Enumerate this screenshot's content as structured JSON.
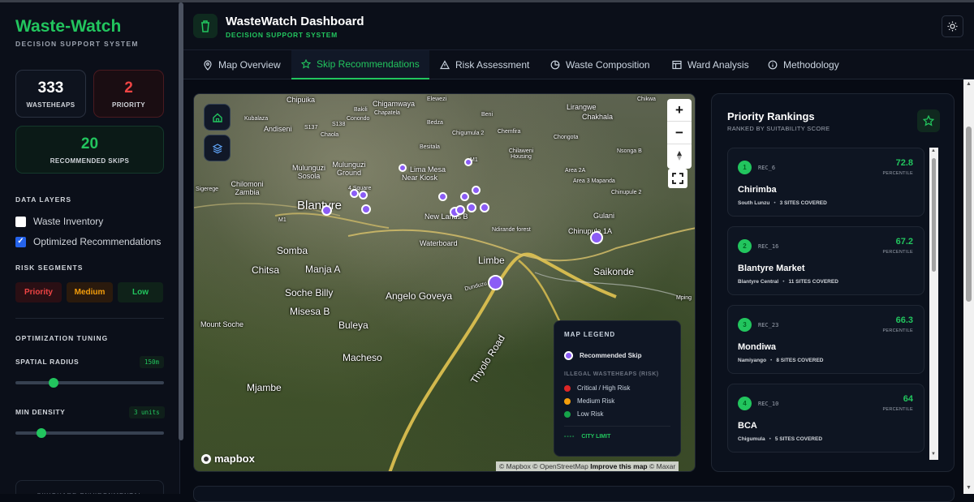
{
  "sidebar": {
    "brand": "Waste-Watch",
    "brand_sub": "DECISION SUPPORT SYSTEM",
    "stats": {
      "wasteheaps": {
        "value": "333",
        "label": "WASTEHEAPS"
      },
      "priority": {
        "value": "2",
        "label": "PRIORITY"
      },
      "recommended": {
        "value": "20",
        "label": "RECOMMENDED SKIPS"
      }
    },
    "data_layers_title": "DATA LAYERS",
    "layers": [
      {
        "label": "Waste Inventory",
        "checked": false
      },
      {
        "label": "Optimized Recommendations",
        "checked": true
      }
    ],
    "risk_title": "RISK SEGMENTS",
    "risk": [
      "Priority",
      "Medium",
      "Low"
    ],
    "tuning_title": "OPTIMIZATION TUNING",
    "spatial_radius": {
      "label": "SPATIAL RADIUS",
      "value": "150m",
      "level": 0.24
    },
    "min_density": {
      "label": "MIN DENSITY",
      "value": "3 units",
      "level": 0.15
    },
    "footer_card": "SKYGUARD ENVIRONMENTAL"
  },
  "header": {
    "title": "WasteWatch Dashboard",
    "subtitle": "DECISION SUPPORT SYSTEM"
  },
  "tabs": [
    {
      "label": "Map Overview",
      "icon": "map-pin-icon"
    },
    {
      "label": "Skip Recommendations",
      "icon": "star-icon",
      "active": true
    },
    {
      "label": "Risk Assessment",
      "icon": "warning-icon"
    },
    {
      "label": "Waste Composition",
      "icon": "pie-chart-icon"
    },
    {
      "label": "Ward Analysis",
      "icon": "table-icon"
    },
    {
      "label": "Methodology",
      "icon": "info-icon"
    }
  ],
  "map": {
    "labels": {
      "chipuika": "Chipuika",
      "bakili": "Bakili",
      "chigamwaya": "Chigamwaya",
      "chapatela": "Chapatela",
      "elewezi": "Elewezi",
      "kubalaza": "Kubalaza",
      "condodo": "Conondo",
      "andiseni": "Andiseni",
      "beni": "Beni",
      "bedza": "Bedza",
      "lirangwe": "Lirangwe",
      "chakhala": "Chakhala",
      "chikwa": "Chikwa",
      "chaola": "Chaola",
      "chigumula2": "Chigumula 2",
      "chemfira": "Chemfira",
      "chongota": "Chongota",
      "besitala": "Besitala",
      "chilaweni": "Chilaweni Housing",
      "nsonga": "Nsonga B",
      "mulunguzi_sosola": "Mulunguzi Sosola",
      "mulunguzi_ground": "Mulunguzi Ground",
      "limamesa": "Lima Mesa",
      "nearkiosk": "Near Kiosk",
      "area2a": "Area 2A",
      "area3": "Area 3 Mapanda",
      "chinupule2": "Chinupule 2",
      "chilomoni": "Chilomoni Zambia",
      "sigerege": "Sigerege",
      "blantyre": "Blantyre",
      "4square": "4 Square",
      "newlands": "New Lands B",
      "ndirande": "Ndirande forest",
      "gulani": "Gulani",
      "chinupule1a": "Chinupule 1A",
      "waterboard": "Waterboard",
      "somba": "Somba",
      "limbe": "Limbe",
      "chitsa": "Chitsa",
      "manja": "Manja A",
      "saikonde": "Saikonde",
      "dunduzu": "Dunduzu 2nd",
      "socheb": "Soche Billy",
      "angelo": "Angelo Goveya",
      "misesa": "Misesa B",
      "mountsoche": "Mount Soche",
      "buleya": "Buleya",
      "macheso": "Macheso",
      "mjambe": "Mjambe",
      "thyolo": "Thyolo Road",
      "mping": "Mping",
      "m1": "M1",
      "s137": "S137",
      "s138": "S138"
    },
    "mapbox": "mapbox",
    "attribution_1": "© Mapbox © OpenStreetMap",
    "attribution_2": "Improve this map",
    "attribution_3": "© Maxar",
    "legend": {
      "title": "MAP LEGEND",
      "recommended": "Recommended Skip",
      "illegal_title": "ILLEGAL WASTEHEAPS (RISK)",
      "critical": "Critical / High Risk",
      "medium": "Medium Risk",
      "low": "Low Risk",
      "city_limit": "CITY LIMIT",
      "colors": {
        "critical": "#dc2626",
        "medium": "#f59e0b",
        "low": "#16a34a",
        "skip": "#8b5cf6"
      }
    }
  },
  "rankings": {
    "title": "Priority Rankings",
    "subtitle": "RANKED BY SUITABILITY SCORE",
    "percentile_label": "PERCENTILE",
    "items": [
      {
        "rank": "1",
        "id": "REC_6",
        "score": "72.8",
        "name": "Chirimba",
        "area": "South Lunzu",
        "sites": "3 SITES COVERED"
      },
      {
        "rank": "2",
        "id": "REC_16",
        "score": "67.2",
        "name": "Blantyre Market",
        "area": "Blantyre Central",
        "sites": "11 SITES COVERED"
      },
      {
        "rank": "3",
        "id": "REC_23",
        "score": "66.3",
        "name": "Mondiwa",
        "area": "Namiyango",
        "sites": "8 SITES COVERED"
      },
      {
        "rank": "4",
        "id": "REC_10",
        "score": "64",
        "name": "BCA",
        "area": "Chigumula",
        "sites": "5 SITES COVERED"
      }
    ]
  }
}
